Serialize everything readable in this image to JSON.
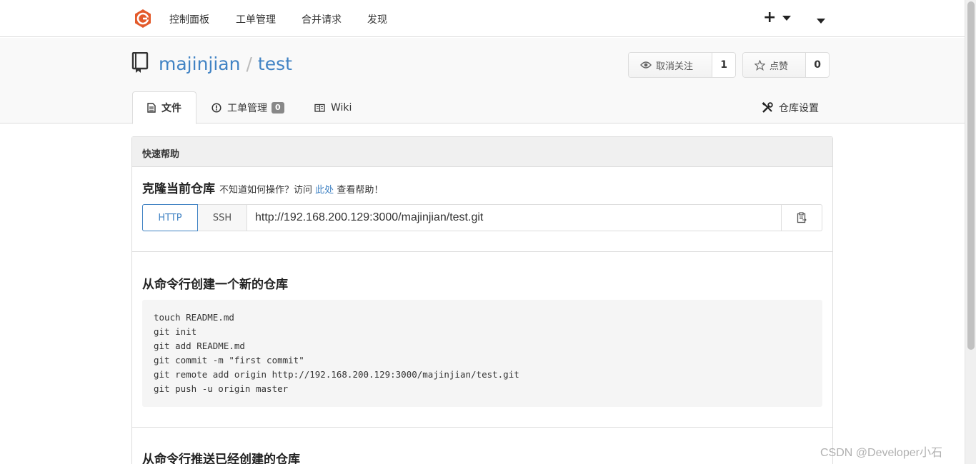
{
  "nav": {
    "items": [
      "控制面板",
      "工单管理",
      "合并请求",
      "发现"
    ],
    "plus": "+"
  },
  "repo": {
    "owner": "majinjian",
    "separator": "/",
    "name": "test",
    "watch": {
      "label": "取消关注",
      "count": "1"
    },
    "star": {
      "label": "点赞",
      "count": "0"
    }
  },
  "tabs": {
    "files": "文件",
    "issues": "工单管理",
    "issues_count": "0",
    "wiki": "Wiki",
    "settings": "仓库设置"
  },
  "quick_help": {
    "header": "快速帮助",
    "clone_title": "克隆当前仓库",
    "clone_hint_before": "不知道如何操作？访问",
    "clone_hint_link": "此处",
    "clone_hint_after": "查看帮助！",
    "protocols": [
      "HTTP",
      "SSH"
    ],
    "clone_url": "http://192.168.200.129:3000/majinjian/test.git",
    "new_repo_title": "从命令行创建一个新的仓库",
    "new_repo_commands": [
      "touch README.md",
      "git init",
      "git add README.md",
      "git commit -m \"first commit\"",
      "git remote add origin http://192.168.200.129:3000/majinjian/test.git",
      "git push -u origin master"
    ],
    "push_existing_title": "从命令行推送已经创建的仓库"
  },
  "watermark": "CSDN @Developer小石",
  "colors": {
    "link": "#4183c4",
    "logo": "#e35a2b"
  },
  "icons": [
    "gitea-logo",
    "book-icon",
    "eye-icon",
    "star-icon",
    "file-text-icon",
    "issue-opened-icon",
    "book-open-icon",
    "tools-icon",
    "clipboard-icon"
  ]
}
